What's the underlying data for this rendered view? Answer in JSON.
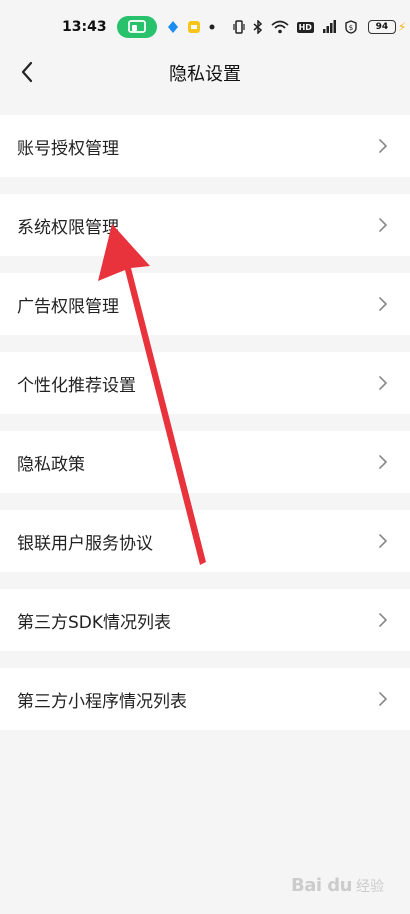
{
  "status_bar": {
    "time": "13:43",
    "network_badge": "HD",
    "battery_level": "94"
  },
  "header": {
    "title": "隐私设置"
  },
  "menu": {
    "items": [
      {
        "label": "账号授权管理"
      },
      {
        "label": "系统权限管理"
      },
      {
        "label": "广告权限管理"
      },
      {
        "label": "个性化推荐设置"
      },
      {
        "label": "隐私政策"
      },
      {
        "label": "银联用户服务协议"
      },
      {
        "label": "第三方SDK情况列表"
      },
      {
        "label": "第三方小程序情况列表"
      }
    ]
  },
  "watermark": {
    "brand": "Bai du",
    "sub": "经验"
  },
  "colors": {
    "accent_green": "#27c26b",
    "annotation_red": "#e8323c",
    "background": "#f5f5f5"
  }
}
